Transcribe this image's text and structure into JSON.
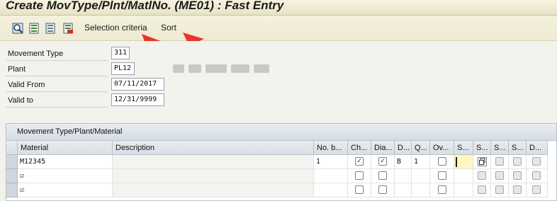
{
  "window": {
    "title": "Create MovType/Plnt/MatlNo. (ME01) : Fast Entry"
  },
  "toolbar": {
    "icons": [
      "details-icon",
      "select-all-icon",
      "deselect-all-icon",
      "delete-icon"
    ],
    "selection_criteria_label": "Selection criteria",
    "sort_label": "Sort"
  },
  "form": {
    "movement_type_label": "Movement Type",
    "movement_type_value": "311",
    "plant_label": "Plant",
    "plant_value": "PL12",
    "valid_from_label": "Valid From",
    "valid_from_value": "07/11/2017",
    "valid_to_label": "Valid to",
    "valid_to_value": "12/31/9999"
  },
  "table": {
    "title": "Movement Type/Plant/Material",
    "columns": [
      "Material",
      "Description",
      "No. b...",
      "Ch...",
      "Dia...",
      "D...",
      "Q...",
      "Ov...",
      "S...",
      "S...",
      "S...",
      "S...",
      "D..."
    ],
    "rows": [
      {
        "material": "M12345",
        "description": "",
        "no_b": "1",
        "ch": true,
        "dia": true,
        "d": "B",
        "q": "1",
        "ov": false
      },
      {
        "material": "☑",
        "description": "",
        "no_b": "",
        "ch": false,
        "dia": false,
        "d": "",
        "q": "",
        "ov": false
      },
      {
        "material": "☑",
        "description": "",
        "no_b": "",
        "ch": false,
        "dia": false,
        "d": "",
        "q": "",
        "ov": false
      }
    ]
  },
  "colors": {
    "arrow": "#e8352b",
    "title_bg": "#efebd3",
    "header_bg": "#dde3e9"
  }
}
